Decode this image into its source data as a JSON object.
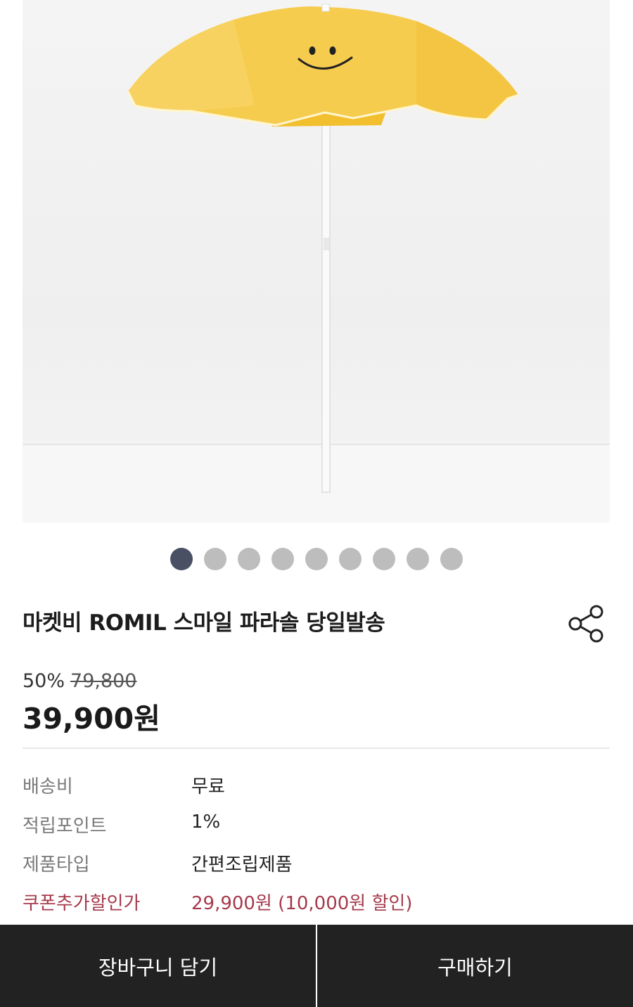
{
  "product": {
    "image_alt": "노란 스마일 파라솔",
    "carousel_total": 9,
    "carousel_active_index": 0,
    "title": "마켓비 ROMIL 스마일 파라솔 당일발송",
    "discount_percent": "50%",
    "original_price": "79,800",
    "sale_price": "39,900원"
  },
  "share": {
    "icon": "share-icon"
  },
  "info": [
    {
      "label": "배송비",
      "value": "무료"
    },
    {
      "label": "적립포인트",
      "value": "1%"
    },
    {
      "label": "제품타입",
      "value": "간편조립제품"
    },
    {
      "label": "쿠폰추가할인가",
      "value": "29,900원 (10,000원 할인)"
    }
  ],
  "actions": {
    "cart_label": "장바구니 담기",
    "buy_label": "구매하기"
  },
  "colors": {
    "accent_coupon": "#a63a4b",
    "dot_active": "#4a5063",
    "dot_inactive": "#bdbdbd",
    "bottom_bar": "#222222",
    "umbrella": "#f5c842"
  }
}
